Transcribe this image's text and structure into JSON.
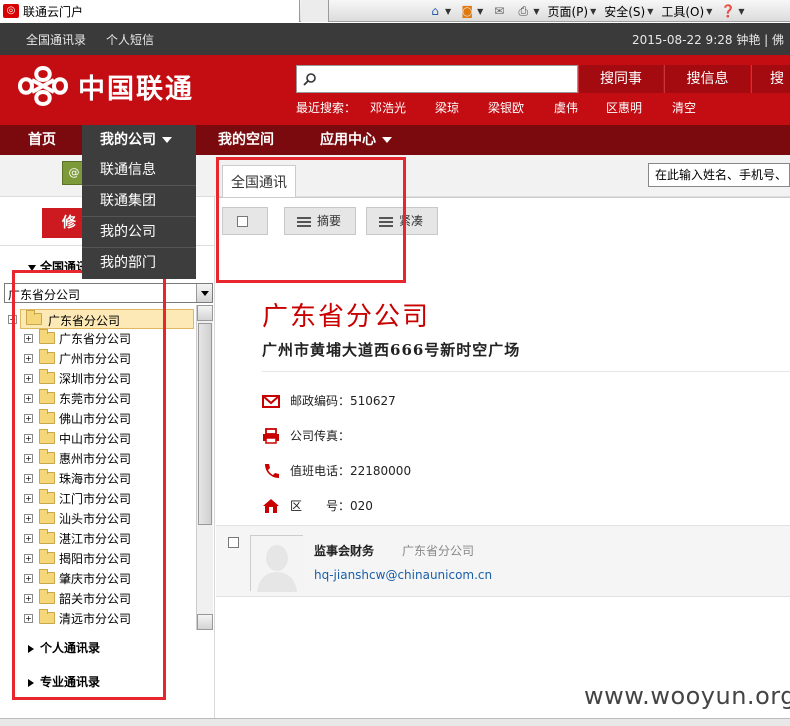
{
  "browser": {
    "tab_title": "联通云门户",
    "tools": [
      {
        "icon": "home-icon",
        "label": ""
      },
      {
        "icon": "rss-icon",
        "label": ""
      },
      {
        "icon": "mail-icon",
        "label": ""
      },
      {
        "icon": "print-icon",
        "label": ""
      },
      {
        "icon": "page-icon",
        "label": "页面(P)"
      },
      {
        "icon": "safety-icon",
        "label": "安全(S)"
      },
      {
        "icon": "tools-icon",
        "label": "工具(O)"
      },
      {
        "icon": "help-icon",
        "label": ""
      }
    ]
  },
  "topbar": {
    "links": [
      "全国通讯录",
      "个人短信"
    ],
    "datetime": "2015-08-22 9:28 钟艳 | 佛"
  },
  "header": {
    "logo_text": "中国联通",
    "search_placeholder": "",
    "buttons": [
      "搜同事",
      "搜信息",
      "搜"
    ],
    "hot_label": "最近搜索：",
    "hot_keywords": [
      "邓浩光",
      "梁琼",
      "梁银欧",
      "虞伟",
      "区惠明",
      "清空"
    ]
  },
  "nav": {
    "items": [
      {
        "label": "首页",
        "has_caret": false
      },
      {
        "label": "我的公司",
        "has_caret": true
      },
      {
        "label": "我的空间",
        "has_caret": false
      },
      {
        "label": "应用中心",
        "has_caret": true
      }
    ],
    "submenu": [
      "联通信息",
      "联通集团",
      "我的公司",
      "我的部门"
    ]
  },
  "strip": {
    "quick_search": "在此输入姓名、手机号、"
  },
  "left": {
    "modify_button": "修改",
    "category_label": "全国通讯",
    "combo_value": "广东省分公司",
    "tree_root": "广东省分公司",
    "tree_nodes": [
      "广东省分公司",
      "广州市分公司",
      "深圳市分公司",
      "东莞市分公司",
      "佛山市分公司",
      "中山市分公司",
      "惠州市分公司",
      "珠海市分公司",
      "江门市分公司",
      "汕头市分公司",
      "湛江市分公司",
      "揭阳市分公司",
      "肇庆市分公司",
      "韶关市分公司",
      "清远市分公司"
    ],
    "sections": [
      "个人通讯录",
      "专业通讯录"
    ]
  },
  "main": {
    "tab_label": "全国通讯",
    "btn_summary": "摘要",
    "btn_compact": "紧凑",
    "company_title": "广东省分公司",
    "company_address": "广州市黄埔大道西666号新时空广场",
    "info": [
      {
        "icon": "mail-icon",
        "label": "邮政编码：510627"
      },
      {
        "icon": "fax-icon",
        "label": "公司传真："
      },
      {
        "icon": "phone-icon",
        "label": "值班电话：22180000"
      },
      {
        "icon": "home-icon",
        "label": "区　　号：020"
      }
    ],
    "card": {
      "name": "监事会财务",
      "org": "广东省分公司",
      "email": "hq-jianshcw@chinaunicom.cn"
    }
  },
  "watermark": "www.wooyun.org",
  "colors": {
    "brand_red": "#c30d13",
    "nav_dark_red": "#7a0a0d",
    "highlight_box": "#e8262d"
  }
}
